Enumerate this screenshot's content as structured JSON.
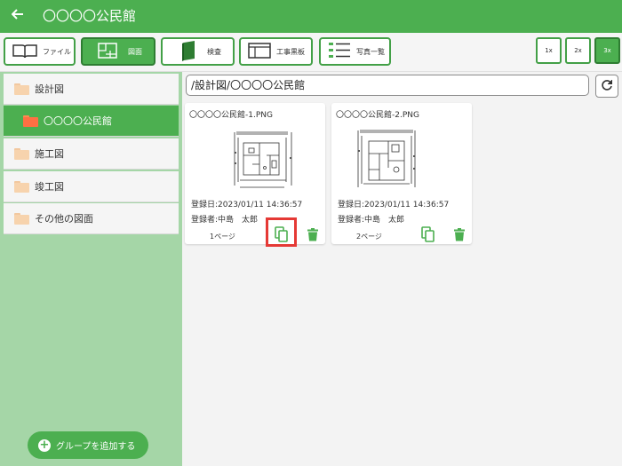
{
  "header": {
    "title": "〇〇〇〇公民館"
  },
  "toolbar": {
    "buttons": [
      {
        "label": "ファイル",
        "icon": "book-icon"
      },
      {
        "label": "図面",
        "icon": "floorplan-icon"
      },
      {
        "label": "検査",
        "icon": "notebook-icon"
      },
      {
        "label": "工事黒板",
        "icon": "blackboard-icon"
      },
      {
        "label": "写真一覧",
        "icon": "list-icon"
      }
    ],
    "zoom": [
      "1x",
      "2x",
      "3x"
    ],
    "active_zoom": "3x"
  },
  "sidebar": {
    "items": [
      {
        "label": "設計図"
      },
      {
        "label": "〇〇〇〇公民館"
      },
      {
        "label": "施工図"
      },
      {
        "label": "竣工図"
      },
      {
        "label": "その他の図面"
      }
    ],
    "add_group_label": "グループを追加する"
  },
  "content": {
    "path": "/設計図/〇〇〇〇公民館",
    "cards": [
      {
        "filename": "〇〇〇〇公民館-1.PNG",
        "registered_date": "登録日:2023/01/11 14:36:57",
        "registrant": "登録者:中島　太郎",
        "page": "1ページ"
      },
      {
        "filename": "〇〇〇〇公民館-2.PNG",
        "registered_date": "登録日:2023/01/11 14:36:57",
        "registrant": "登録者:中島　太郎",
        "page": "2ページ"
      }
    ]
  },
  "colors": {
    "primary": "#4caf50",
    "sidebar_bg": "#a5d6a7",
    "highlight": "#e53935",
    "folder": "#f7d3ad",
    "folder_active": "#ff7043"
  }
}
